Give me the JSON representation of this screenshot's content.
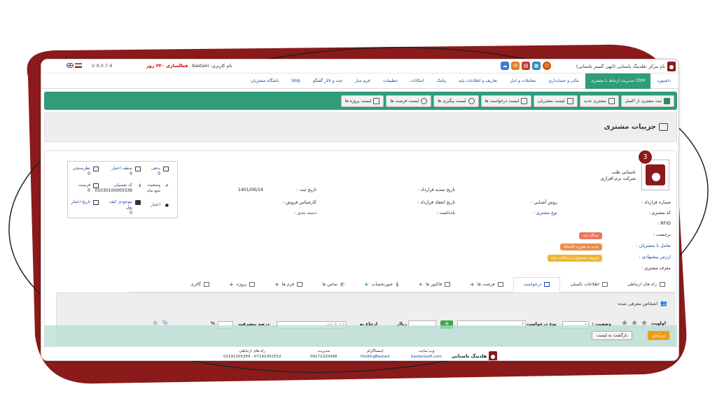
{
  "topbar": {
    "brand_text": "نام مرکز :هلدینگ باستانی (ابهی گستر باستانی)",
    "username_label": "نام کاربری: bastani",
    "subscription": "فعالسازی ۳۳۰ روز",
    "version": "V 9.0.7.4"
  },
  "menu": {
    "items": [
      {
        "label": "داشبورد"
      },
      {
        "label": "مدیریت ارتباط با مشتری CRM"
      },
      {
        "label": "مالی و حسابداری"
      },
      {
        "label": "معاملات و انبار"
      },
      {
        "label": "تعاریف و اطلاعات پایه"
      },
      {
        "label": "پیامک"
      },
      {
        "label": "امکانات"
      },
      {
        "label": "تنظیمات"
      },
      {
        "label": "فرم ساز"
      },
      {
        "label": "چت و تالار گفتگو"
      },
      {
        "label": "Voip"
      },
      {
        "label": "باشگاه مشتریان"
      }
    ]
  },
  "toolbar": {
    "buttons": [
      {
        "label": "ثبت مشتری از اکسل"
      },
      {
        "label": "مشتری جدید"
      },
      {
        "label": "لیست مشتریان"
      },
      {
        "label": "لیست درخواست ها"
      },
      {
        "label": "لیست پیگیری ها"
      },
      {
        "label": "لیست فرصت ها"
      },
      {
        "label": "لیست پروژه ها"
      }
    ]
  },
  "page": {
    "title": "جزییات مشتری",
    "step_badge": "3"
  },
  "customer": {
    "name_line1": "باستانی طب",
    "name_line2": "شرکت نرم افزاری",
    "fields": {
      "contract_no": "شماره قرارداد :",
      "customer_code": "کد مشتری :",
      "rfid": "RFID :",
      "tag": "برچسب :",
      "interaction": "تعامل با مشتریان :",
      "proposed_value": "ارزش پیشنهادی :",
      "referrer": "معرف مشتری :",
      "acquaintance": "روش آشنایی :",
      "customer_type": "نوع مشتری :",
      "contract_renewal": "تاریخ تمدید قرارداد :",
      "contract_conclusion": "تاریخ انعقاد قرارداد :",
      "note": "یادداشت :",
      "register_date_label": "تاریخ ثبت :",
      "register_date_value": "1401/06/14",
      "sales_expert": "کارشناس فروش :",
      "category": "دسته بندی :"
    },
    "tags": [
      {
        "text": "دیدگاه پایه",
        "color": "#e9775f"
      },
      {
        "text": "خرید به صورت اقساط",
        "color": "#e98f4f"
      },
      {
        "text": "فروش محصول در ساعات شاد",
        "color": "#efb534"
      }
    ]
  },
  "stats": {
    "debt_label": "بدهی",
    "debt_value": "0",
    "credit_ceiling_label": "سقف اعتبار",
    "credit_ceiling_value": "0",
    "survey_label": "نظرسنجی",
    "survey_value": "0",
    "status_label": "وضعیت",
    "status_value": "شیع تمام",
    "detail_code_label": "کد تفصیلی",
    "detail_code_value": "01030100000339",
    "opportunity_label": "فرصت",
    "opportunity_value": "0",
    "credit_label": "اعتبار",
    "wallet_label": "موجودی کیف پول",
    "wallet_value": "0",
    "credit_date_label": "تاریخ اعتبار"
  },
  "tabs": [
    {
      "label": "راه های ارتباطی",
      "plus": false
    },
    {
      "label": "اطلاعات تکمیلی",
      "plus": false
    },
    {
      "label": "درخواست",
      "plus": false,
      "active": true
    },
    {
      "label": "فرصت ها",
      "plus": true
    },
    {
      "label": "فاکتور ها",
      "plus": true
    },
    {
      "label": "صورتحساب",
      "plus": true
    },
    {
      "label": "تماس ها",
      "plus": false
    },
    {
      "label": "فرم ها",
      "plus": true
    },
    {
      "label": "پروژه",
      "plus": true
    },
    {
      "label": "گالری",
      "plus": false
    }
  ],
  "tab_body": {
    "referred_people": "اشخاص معرفی شده",
    "priority_label": "اولویت",
    "status_label": "وضعیت :",
    "request_type_label": "نوع درخواست",
    "refer_label": "ارجاع به",
    "refer_placeholder": "0 از 0 پایان",
    "progress_label": "درصد پیشرفت",
    "progress_unit": "%",
    "currency_mark": "ریال"
  },
  "actions": {
    "edit": "ویرایش",
    "back": "بازگشت به لیست"
  },
  "footer": {
    "brand": "هلدینگ باستانی",
    "website_label": "وب سایت",
    "website_value": "bastanisoft.com",
    "instagram_label": "اینستاگرام",
    "instagram_value": "HoldingBastani",
    "management_label": "مدیریت",
    "management_value": "09171020498",
    "contact_label": "راه های ارتباطی",
    "contact_value": "07191002552 - 02191305359"
  }
}
